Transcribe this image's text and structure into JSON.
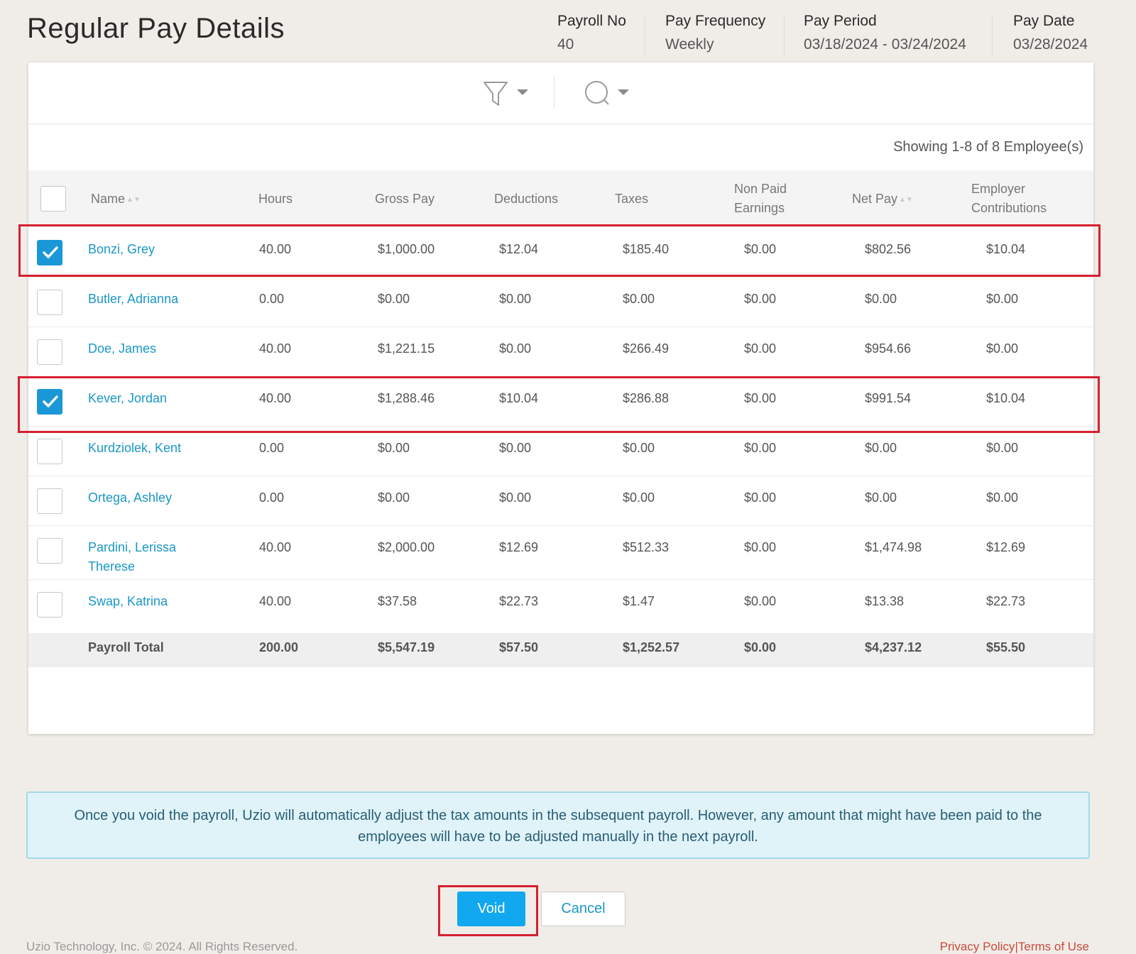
{
  "page": {
    "title": "Regular Pay Details",
    "meta": [
      {
        "label": "Payroll No",
        "value": "40"
      },
      {
        "label": "Pay Frequency",
        "value": "Weekly"
      },
      {
        "label": "Pay Period",
        "value": "03/18/2024 - 03/24/2024"
      },
      {
        "label": "Pay Date",
        "value": "03/28/2024"
      }
    ]
  },
  "toolbar": {
    "filter_icon": "filter-icon",
    "search_icon": "search-icon"
  },
  "showing_text": "Showing 1-8 of 8 Employee(s)",
  "table": {
    "headers": {
      "name": "Name",
      "hours": "Hours",
      "gross": "Gross Pay",
      "deductions": "Deductions",
      "taxes": "Taxes",
      "non_paid_1": "Non Paid",
      "non_paid_2": "Earnings",
      "net": "Net Pay",
      "employer_1": "Employer",
      "employer_2": "Contributions"
    },
    "rows": [
      {
        "checked": true,
        "name": "Bonzi, Grey",
        "hours": "40.00",
        "gross": "$1,000.00",
        "deductions": "$12.04",
        "taxes": "$185.40",
        "non_paid": "$0.00",
        "net": "$802.56",
        "employer": "$10.04"
      },
      {
        "checked": false,
        "name": "Butler, Adrianna",
        "hours": "0.00",
        "gross": "$0.00",
        "deductions": "$0.00",
        "taxes": "$0.00",
        "non_paid": "$0.00",
        "net": "$0.00",
        "employer": "$0.00"
      },
      {
        "checked": false,
        "name": "Doe, James",
        "hours": "40.00",
        "gross": "$1,221.15",
        "deductions": "$0.00",
        "taxes": "$266.49",
        "non_paid": "$0.00",
        "net": "$954.66",
        "employer": "$0.00"
      },
      {
        "checked": true,
        "name": "Kever, Jordan",
        "hours": "40.00",
        "gross": "$1,288.46",
        "deductions": "$10.04",
        "taxes": "$286.88",
        "non_paid": "$0.00",
        "net": "$991.54",
        "employer": "$10.04"
      },
      {
        "checked": false,
        "name": "Kurdziolek, Kent",
        "hours": "0.00",
        "gross": "$0.00",
        "deductions": "$0.00",
        "taxes": "$0.00",
        "non_paid": "$0.00",
        "net": "$0.00",
        "employer": "$0.00"
      },
      {
        "checked": false,
        "name": "Ortega, Ashley",
        "hours": "0.00",
        "gross": "$0.00",
        "deductions": "$0.00",
        "taxes": "$0.00",
        "non_paid": "$0.00",
        "net": "$0.00",
        "employer": "$0.00"
      },
      {
        "checked": false,
        "name": "Pardini, Lerissa",
        "name2": "Therese",
        "hours": "40.00",
        "gross": "$2,000.00",
        "deductions": "$12.69",
        "taxes": "$512.33",
        "non_paid": "$0.00",
        "net": "$1,474.98",
        "employer": "$12.69"
      },
      {
        "checked": false,
        "name": "Swap, Katrina",
        "hours": "40.00",
        "gross": "$37.58",
        "deductions": "$22.73",
        "taxes": "$1.47",
        "non_paid": "$0.00",
        "net": "$13.38",
        "employer": "$22.73"
      }
    ],
    "total": {
      "label": "Payroll Total",
      "hours": "200.00",
      "gross": "$5,547.19",
      "deductions": "$57.50",
      "taxes": "$1,252.57",
      "non_paid": "$0.00",
      "net": "$4,237.12",
      "employer": "$55.50"
    }
  },
  "notice": "Once you void the payroll, Uzio will automatically adjust the tax amounts in the subsequent payroll. However, any amount that might have been paid to the employees will have to be adjusted manually in the next payroll.",
  "buttons": {
    "void": "Void",
    "cancel": "Cancel"
  },
  "footer": {
    "copyright": "Uzio Technology, Inc. © 2024. All Rights Reserved.",
    "privacy": "Privacy Policy",
    "separator": "|",
    "terms": "Terms of Use"
  },
  "colors": {
    "accent": "#1a97d6",
    "highlight": "#d62030",
    "link": "#1a97c6"
  }
}
